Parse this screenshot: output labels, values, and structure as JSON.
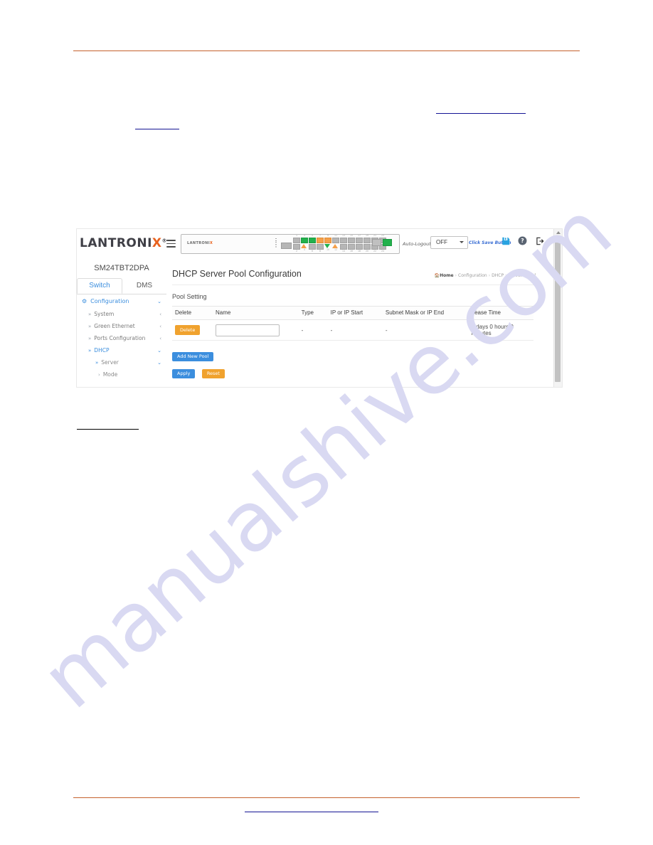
{
  "document": {
    "rule_color": "#c4622d",
    "link_color": "#141494",
    "watermark": "manualshive.com"
  },
  "app": {
    "brand": {
      "prefix": "LANTRONI",
      "accent_letter": "X",
      "registered": "®"
    },
    "hamburger_icon": "hamburger-menu-icon",
    "device": {
      "logo_prefix": "LANTRONI",
      "logo_accent": "X",
      "port_numbers_top": [
        "1",
        "3",
        "5",
        "7",
        "9",
        "11",
        "13",
        "15",
        "17",
        "19",
        "21",
        "23",
        "25",
        "27"
      ],
      "port_numbers_bottom": [
        "2",
        "4",
        "6",
        "8",
        "10",
        "12",
        "14",
        "16",
        "18",
        "20",
        "22",
        "24",
        "26",
        "28"
      ],
      "indicator_top": "1",
      "indicator_bottom": "0"
    },
    "toolbar": {
      "auto_logout_label": "Auto-Logout",
      "auto_logout_value": "OFF",
      "auto_logout_options": [
        "OFF"
      ],
      "click_save_text": "Click Save Button",
      "save_icon": "save-floppy-icon",
      "help_icon": "help-question-icon",
      "logout_icon": "logout-icon",
      "save_icon_color": "#29a3e0"
    },
    "sidebar": {
      "model": "SM24TBT2DPA",
      "tabs": [
        {
          "label": "Switch",
          "active": true
        },
        {
          "label": "DMS",
          "active": false
        }
      ],
      "items": [
        {
          "label": "Configuration",
          "level": 0,
          "icon": "gear-icon",
          "arrow": "⌄",
          "active": true
        },
        {
          "label": "System",
          "level": 1,
          "arrow": "‹",
          "active": false
        },
        {
          "label": "Green Ethernet",
          "level": 1,
          "arrow": "‹",
          "active": false
        },
        {
          "label": "Ports Configuration",
          "level": 1,
          "arrow": "‹",
          "active": false
        },
        {
          "label": "DHCP",
          "level": 1,
          "arrow": "⌄",
          "active": true
        },
        {
          "label": "Server",
          "level": 2,
          "arrow": "⌄",
          "active": true
        },
        {
          "label": "Mode",
          "level": 3,
          "arrow": "",
          "active": false
        }
      ]
    },
    "main": {
      "page_title": "DHCP Server Pool Configuration",
      "breadcrumb": {
        "home_icon": "home-icon",
        "items": [
          "Home",
          "Configuration",
          "DHCP",
          "Server",
          "Pool"
        ],
        "separator": "›"
      },
      "section_title": "Pool Setting",
      "table": {
        "columns": [
          "Delete",
          "Name",
          "Type",
          "IP or IP Start",
          "Subnet Mask or IP End",
          "Lease Time"
        ],
        "rows": [
          {
            "delete_label": "Delete",
            "name_value": "",
            "name_placeholder": "",
            "type": "-",
            "ip_or_ip_start": "-",
            "subnet_mask_or_ip_end": "-",
            "lease_time": "1 days 0 hours 0 minutes"
          }
        ]
      },
      "buttons": {
        "add_new_pool": "Add New Pool",
        "apply": "Apply",
        "reset": "Reset"
      }
    },
    "colors": {
      "accent_blue": "#3b8ede",
      "accent_orange": "#f0a22e",
      "brand_orange": "#e8621f"
    }
  }
}
